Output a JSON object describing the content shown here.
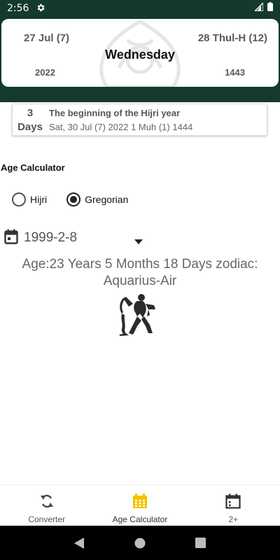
{
  "status_bar": {
    "time": "2:56",
    "icons": [
      "gear-icon",
      "signal-icon",
      "battery-icon"
    ]
  },
  "header": {
    "gregorian_date": "27 Jul (7)",
    "hijri_date": "28 Thul-H (12)",
    "weekday": "Wednesday",
    "gregorian_year": "2022",
    "hijri_year": "1443"
  },
  "event": {
    "days_count": "3",
    "days_unit": "Days",
    "title": "The beginning of the Hijri year",
    "detail": "Sat, 30 Jul (7) 2022 1 Muh (1) 1444"
  },
  "age_calculator": {
    "section_title": "Age Calculator",
    "options": [
      {
        "label": "Hijri",
        "selected": false
      },
      {
        "label": "Gregorian",
        "selected": true
      }
    ],
    "birth_date": "1999-2-8",
    "result_line1": "Age:23 Years 5 Months 18 Days zodiac:",
    "result_line2": "Aquarius-Air",
    "zodiac_icon": "aquarius-figure-icon"
  },
  "bottom_nav": {
    "items": [
      {
        "label": "Converter",
        "icon": "refresh-icon",
        "active": false
      },
      {
        "label": "Age Calculator",
        "icon": "calendar-icon",
        "active": true
      },
      {
        "label": "2+",
        "icon": "calendar-outline-icon",
        "active": false
      }
    ]
  },
  "colors": {
    "header_bg": "#133a2c",
    "calendar_accent": "#f5c400"
  }
}
